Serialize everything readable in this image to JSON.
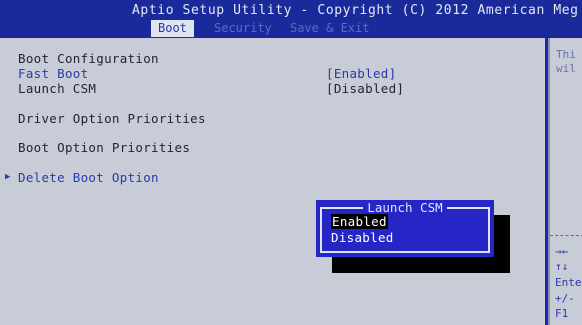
{
  "header": {
    "title": "Aptio Setup Utility - Copyright (C) 2012 American Meg",
    "tabs": [
      {
        "label": "Boot",
        "active": true
      },
      {
        "label": "Security",
        "active": false
      },
      {
        "label": "Save & Exit",
        "active": false
      }
    ]
  },
  "main": {
    "section_title": "Boot Configuration",
    "items": [
      {
        "label": "Fast Boot",
        "value": "[Enabled]"
      },
      {
        "label": "Launch CSM",
        "value": "[Disabled]"
      },
      {
        "label": "Driver Option Priorities"
      },
      {
        "label": "Boot Option Priorities"
      },
      {
        "label": "Delete Boot Option",
        "submenu": true
      }
    ]
  },
  "help": {
    "text_lines": [
      "Thi",
      "wil"
    ],
    "keys": [
      "→←",
      "↑↓",
      "Ente",
      "+/-",
      "F1"
    ]
  },
  "popup": {
    "title": "Launch CSM",
    "options": [
      "Enabled",
      "Disabled"
    ],
    "selected": "Enabled"
  },
  "colors": {
    "background": "#1f28a8",
    "panel": "#c8ccd6",
    "accent_text": "#2a3aa8",
    "popup": "#2626c6",
    "popup_selection": "#000000"
  }
}
